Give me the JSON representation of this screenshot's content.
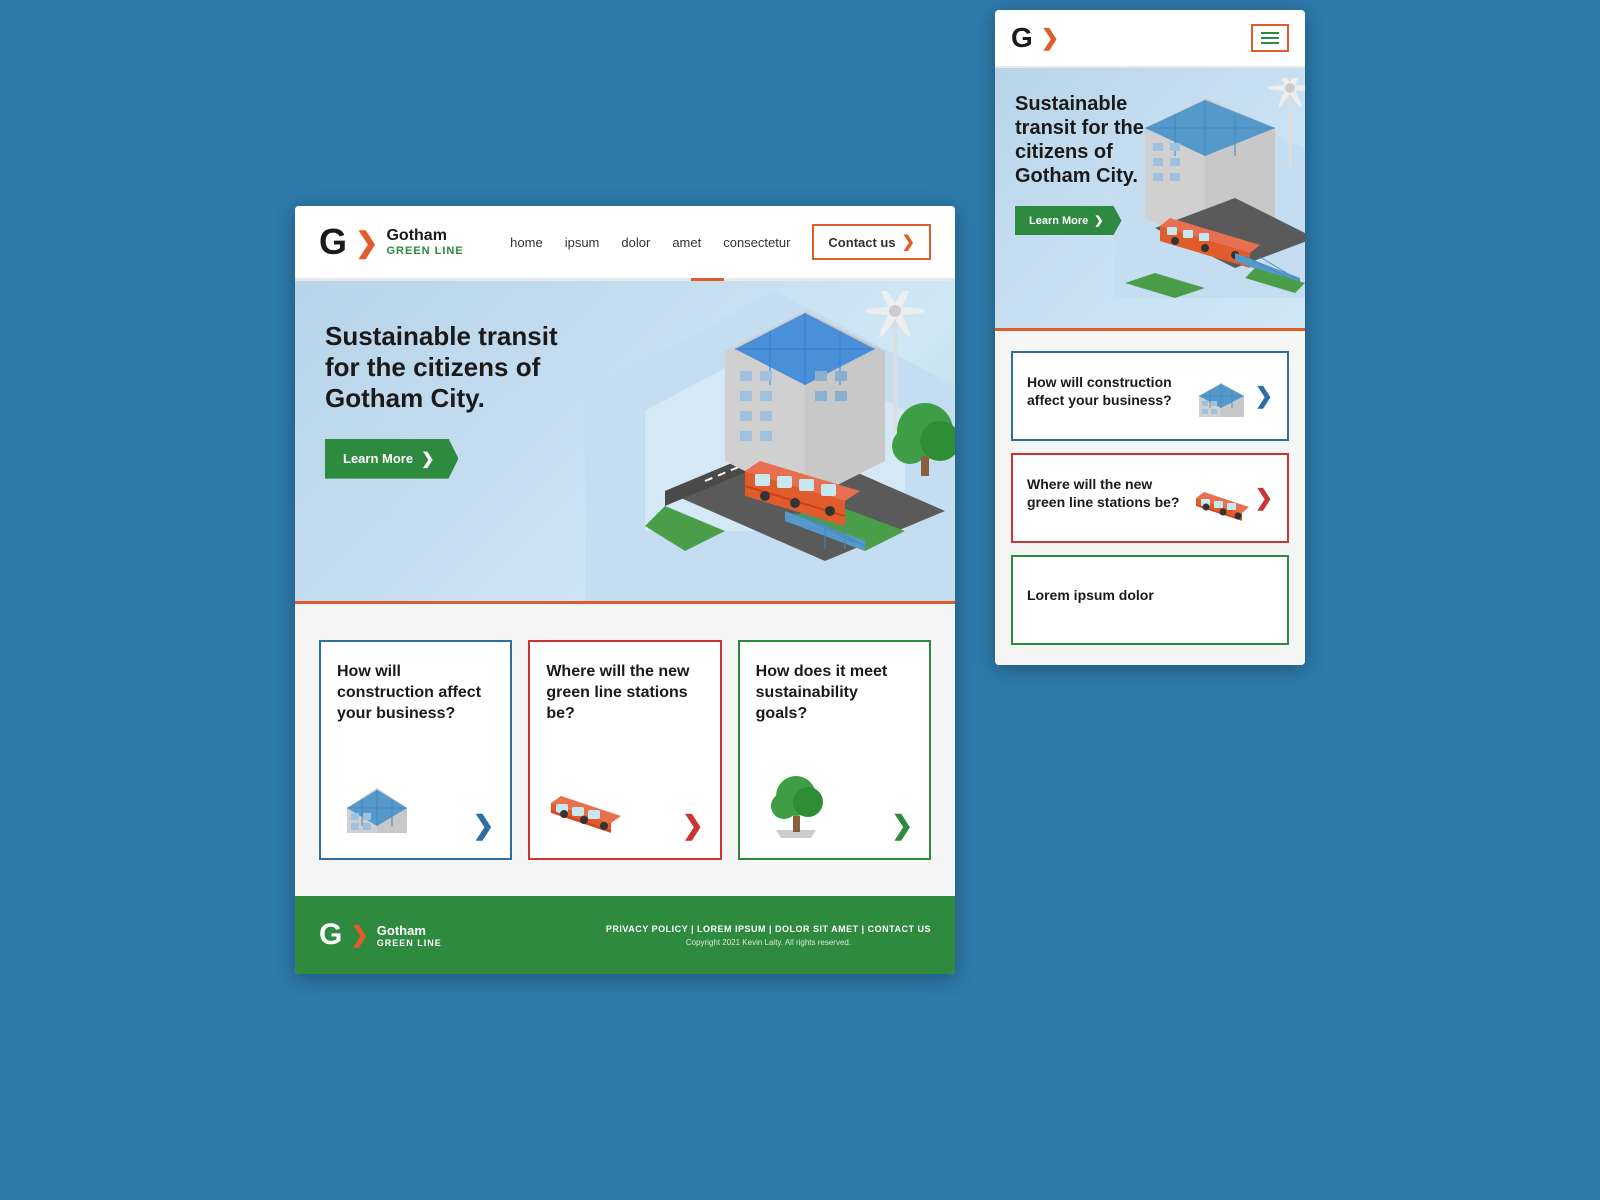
{
  "brand": {
    "name": "Gotham",
    "line": "GREEN LINE",
    "logo_letter": "G",
    "logo_arrow": "❯"
  },
  "nav": {
    "links": [
      "home",
      "ipsum",
      "dolor",
      "amet",
      "consectetur"
    ],
    "contact_label": "Contact us"
  },
  "hero": {
    "title": "Sustainable transit for the citizens of Gotham City.",
    "learn_more_label": "Learn More"
  },
  "cards": [
    {
      "title": "How will construction affect your business?",
      "border_color": "blue",
      "arrow_color": "#2d6fa3",
      "icon": "building"
    },
    {
      "title": "Where will the new green line stations be?",
      "border_color": "red",
      "arrow_color": "#cc3333",
      "icon": "train"
    },
    {
      "title": "How does it meet sustainability goals?",
      "border_color": "green",
      "arrow_color": "#2d8a3e",
      "icon": "tree"
    }
  ],
  "footer": {
    "links": "PRIVACY POLICY  |  LOREM IPSUM  |  DOLOR SIT AMET  |  CONTACT US",
    "copyright": "Copyright 2021 Kevin Laity. All rights reserved."
  },
  "mobile": {
    "hero_title": "Sustainable transit for the citizens of Gotham City.",
    "learn_more_label": "Learn More",
    "cards": [
      {
        "title": "How will construction affect your business?",
        "border": "blue",
        "arrow_color": "#2d6fa3",
        "icon": "building"
      },
      {
        "title": "Where will the new green line stations be?",
        "border": "red",
        "arrow_color": "#cc3333",
        "icon": "train"
      },
      {
        "title": "Lorem ipsum dolor",
        "border": "green",
        "arrow_color": "#2d8a3e",
        "icon": "tree"
      }
    ]
  }
}
